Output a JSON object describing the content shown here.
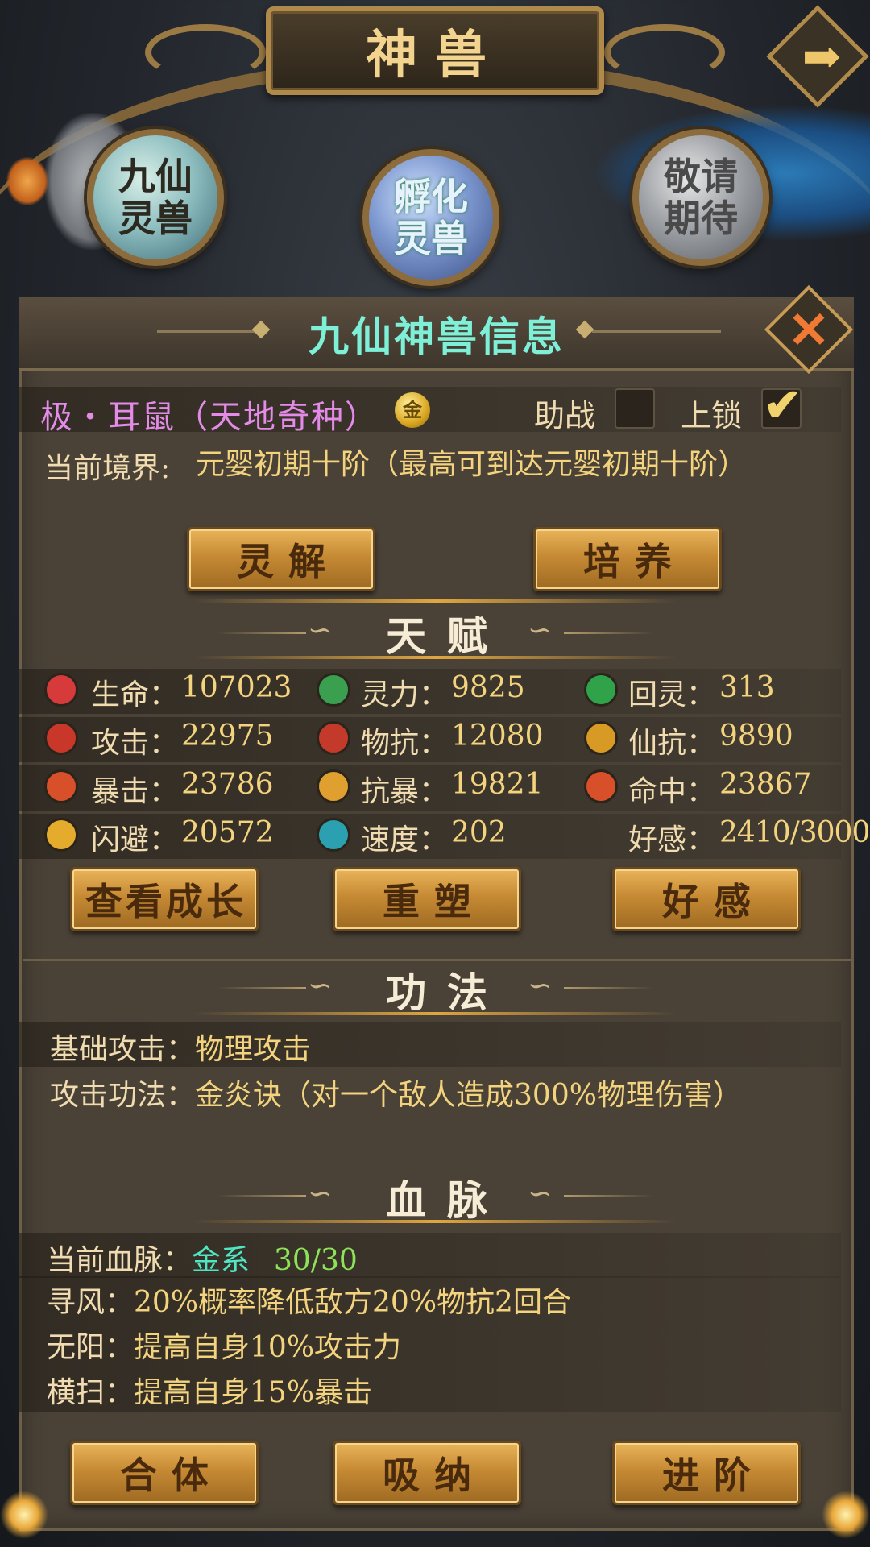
{
  "header": {
    "title": "神兽"
  },
  "orbs": [
    {
      "label": "九仙\n灵兽"
    },
    {
      "label": "孵化\n灵兽"
    },
    {
      "label": "敬请\n期待"
    }
  ],
  "panel": {
    "title": "九仙神兽信息"
  },
  "pet": {
    "name": "极・耳鼠（天地奇种）",
    "coin_char": "金",
    "assist_label": "助战",
    "assist_checked": false,
    "lock_label": "上锁",
    "lock_checked": true,
    "realm_label": "当前境界:",
    "realm_value": "元婴初期十阶（最高可到达元婴初期十阶）"
  },
  "buttons": {
    "spirit": "灵解",
    "cultivate": "培养",
    "view_growth": "查看成长",
    "reshape": "重塑",
    "affection": "好感",
    "merge": "合体",
    "absorb": "吸纳",
    "advance": "进阶"
  },
  "talent": {
    "title": "天赋",
    "stats": [
      {
        "label": "生命：",
        "value": "107023",
        "icon": "heart-icon",
        "color": "#d63a3a"
      },
      {
        "label": "灵力：",
        "value": "9825",
        "icon": "spirit-orb-icon",
        "color": "#3aa050"
      },
      {
        "label": "回灵：",
        "value": "313",
        "icon": "recover-target-icon",
        "color": "#2fa24a"
      },
      {
        "label": "攻击：",
        "value": "22975",
        "icon": "sword-icon",
        "color": "#c8372a"
      },
      {
        "label": "物抗：",
        "value": "12080",
        "icon": "shield-red-icon",
        "color": "#c43a2a"
      },
      {
        "label": "仙抗：",
        "value": "9890",
        "icon": "shield-gold-icon",
        "color": "#d79a24"
      },
      {
        "label": "暴击：",
        "value": "23786",
        "icon": "crit-fist-icon",
        "color": "#d8502a"
      },
      {
        "label": "抗暴：",
        "value": "19821",
        "icon": "block-fist-icon",
        "color": "#e0a030"
      },
      {
        "label": "命中：",
        "value": "23867",
        "icon": "target-icon",
        "color": "#d8502a"
      },
      {
        "label": "闪避：",
        "value": "20572",
        "icon": "dodge-swirl-icon",
        "color": "#e4ab2c"
      },
      {
        "label": "速度：",
        "value": "202",
        "icon": "wind-wave-icon",
        "color": "#2aa0b0"
      },
      {
        "label": "好感：",
        "value": "2410/3000",
        "icon": "",
        "color": ""
      }
    ]
  },
  "skills": {
    "title": "功法",
    "rows": [
      {
        "label": "基础攻击：",
        "value": "物理攻击"
      },
      {
        "label": "攻击功法：",
        "value": "金炎诀（对一个敌人造成300%物理伤害）"
      }
    ]
  },
  "bloodline": {
    "title": "血脉",
    "current_label": "当前血脉：",
    "current_type": "金系",
    "current_count": "30/30",
    "rows": [
      {
        "label": "寻风：",
        "value": "20%概率降低敌方20%物抗2回合"
      },
      {
        "label": "无阳：",
        "value": "提高自身10%攻击力"
      },
      {
        "label": "横扫：",
        "value": "提高自身15%暴击"
      }
    ]
  },
  "colors": {
    "panel_bg": "#4a4237",
    "title_cyan": "#7ef0d8",
    "gold_text": "#f3d37e",
    "pet_name_pink": "#e48be8"
  }
}
